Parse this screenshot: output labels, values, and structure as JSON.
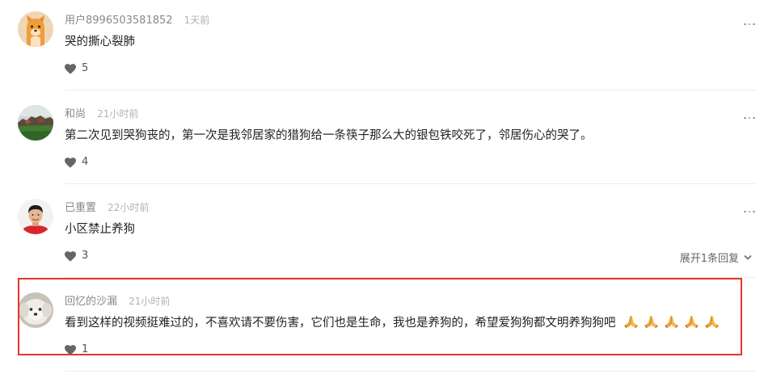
{
  "comments": [
    {
      "avatar_icon": "cartoon-dog-avatar",
      "username": "用户8996503581852",
      "time": "1天前",
      "text": "哭的撕心裂肺",
      "likes": "5"
    },
    {
      "avatar_icon": "landscape-photo-avatar",
      "username": "和尚",
      "time": "21小时前",
      "text": "第二次见到哭狗丧的，第一次是我邻居家的猎狗给一条筷子那么大的银包铁咬死了，邻居伤心的哭了。",
      "likes": "4"
    },
    {
      "avatar_icon": "man-portrait-avatar",
      "username": "已重置",
      "time": "22小时前",
      "text": "小区禁止养狗",
      "likes": "3",
      "expand_replies": "展开1条回复"
    },
    {
      "avatar_icon": "white-dog-avatar",
      "username": "回忆的沙漏",
      "time": "21小时前",
      "text": "看到这样的视频挺难过的，不喜欢请不要伤害，它们也是生命，我也是养狗的，希望爱狗狗都文明养狗狗吧",
      "trailing_icons": [
        "folded-hands-emoji",
        "folded-hands-emoji",
        "folded-hands-emoji",
        "folded-hands-emoji",
        "folded-hands-emoji"
      ],
      "likes": "1",
      "highlighted": true
    }
  ],
  "icons": {
    "like": "heart-icon",
    "more": "more-dots-icon",
    "expand": "chevron-down-icon"
  },
  "colors": {
    "highlight_border": "#e5342d",
    "comment_text": "#222222",
    "username": "#888888",
    "timestamp": "#b3b3b3",
    "icon": "#666666"
  }
}
